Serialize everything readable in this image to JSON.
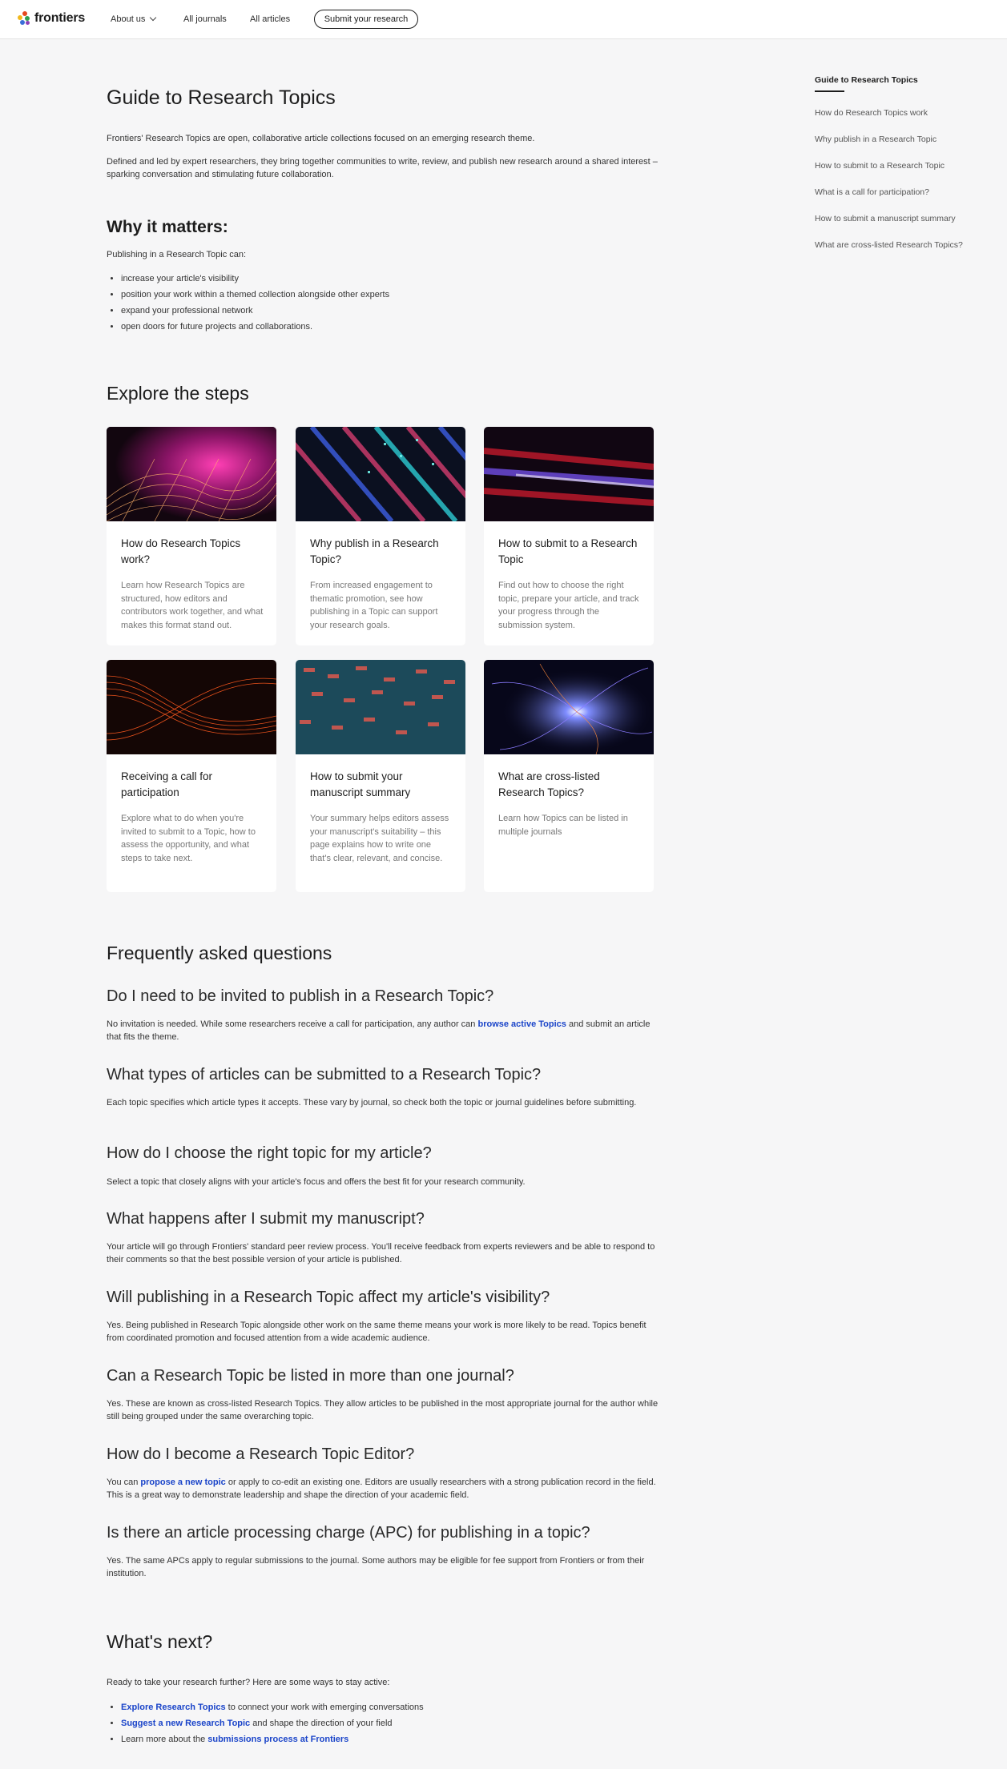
{
  "header": {
    "logo_text": "frontiers",
    "nav": {
      "about": "About us",
      "journals": "All journals",
      "articles": "All articles"
    },
    "submit_label": "Submit your research"
  },
  "intro": {
    "title": "Guide to Research Topics",
    "p1": "Frontiers' Research Topics are open, collaborative article collections focused on an emerging research theme.",
    "p2": "Defined and led by expert researchers, they bring together communities to write, review, and publish new research around a shared interest – sparking conversation and stimulating future collaboration."
  },
  "why": {
    "title": "Why it matters:",
    "lead": "Publishing in a Research Topic can:",
    "items": [
      "increase your article's visibility",
      "position your work within a themed collection alongside other experts",
      "expand your professional network",
      "open doors for future projects and collaborations."
    ]
  },
  "steps": {
    "title": "Explore the steps",
    "cards": [
      {
        "title": "How do Research Topics work?",
        "desc": "Learn how Research Topics are structured, how editors and contributors work together, and what makes this format stand out."
      },
      {
        "title": "Why publish in a Research Topic?",
        "desc": "From increased engagement to thematic promotion, see how publishing in a Topic can support your research goals."
      },
      {
        "title": "How to submit to a Research Topic",
        "desc": "Find out how to choose the right topic, prepare your article, and track your progress through the submission system."
      },
      {
        "title": "Receiving a call for participation",
        "desc": "Explore what to do when you're invited to submit to a Topic, how to assess the opportunity, and what steps to take next."
      },
      {
        "title": "How to submit your manuscript summary",
        "desc": "Your summary helps editors assess your manuscript's suitability – this page explains how to write one that's clear, relevant, and concise."
      },
      {
        "title": "What are cross-listed Research Topics?",
        "desc": "Learn how Topics can be listed in multiple journals"
      }
    ]
  },
  "faq": {
    "title": "Frequently asked questions",
    "items": [
      {
        "q": "Do I need to be invited to publish in a Research Topic?",
        "a_pre": "No invitation is needed. While some researchers receive a call for participation, any author can ",
        "a_link": "browse active Topics",
        "a_post": " and submit an article that fits the theme."
      },
      {
        "q": "What types of articles can be submitted to a Research Topic?",
        "a": "Each topic specifies which article types it accepts. These vary by journal, so check both the topic or journal guidelines before submitting."
      },
      {
        "q": "How do I choose the right topic for my article?",
        "a": "Select a topic that closely aligns with your article's focus and offers the best fit for your research community."
      },
      {
        "q": "What happens after I submit my manuscript?",
        "a": "Your article will go through Frontiers' standard peer review process. You'll receive feedback from experts reviewers and be able to respond to their comments so that the best possible version of your article is published."
      },
      {
        "q": "Will publishing in a Research Topic affect my article's visibility?",
        "a": "Yes. Being published in Research Topic alongside other work on the same theme means your work is more likely to be read. Topics benefit from coordinated promotion and focused attention from a wide academic audience."
      },
      {
        "q": "Can a Research Topic be listed in more than one journal?",
        "a": "Yes. These are known as cross-listed Research Topics. They allow articles to be published in the most appropriate journal for the author while still being grouped under the same overarching topic."
      },
      {
        "q": "How do I become a Research Topic Editor?",
        "a_pre": "You can ",
        "a_link": "propose a new topic",
        "a_post": " or apply to co-edit an existing one. Editors are usually researchers with a strong publication record in the field. This is a great way to demonstrate leadership and shape the direction of your academic field."
      },
      {
        "q": "Is there an article processing charge (APC) for publishing in a topic?",
        "a": "Yes. The same APCs apply to regular submissions to the journal. Some authors may be eligible for fee support from Frontiers or from their institution."
      }
    ]
  },
  "next": {
    "title": "What's next?",
    "lead": "Ready to take your research further? Here are some ways to stay active:",
    "items": [
      {
        "pre": "",
        "link": "Explore Research Topics",
        "post": " to connect your work with emerging conversations"
      },
      {
        "pre": "",
        "link": "Suggest a new Research Topic",
        "post": " and shape the direction of your field"
      },
      {
        "pre": "Learn more about the ",
        "link": "submissions process at Frontiers",
        "post": ""
      }
    ]
  },
  "toc": {
    "items": [
      "Guide to Research Topics",
      "How do Research Topics work",
      "Why publish in a Research Topic",
      "How to submit to a Research Topic",
      "What is a call for participation?",
      "How to submit a manuscript summary",
      "What are cross-listed Research Topics?"
    ]
  }
}
